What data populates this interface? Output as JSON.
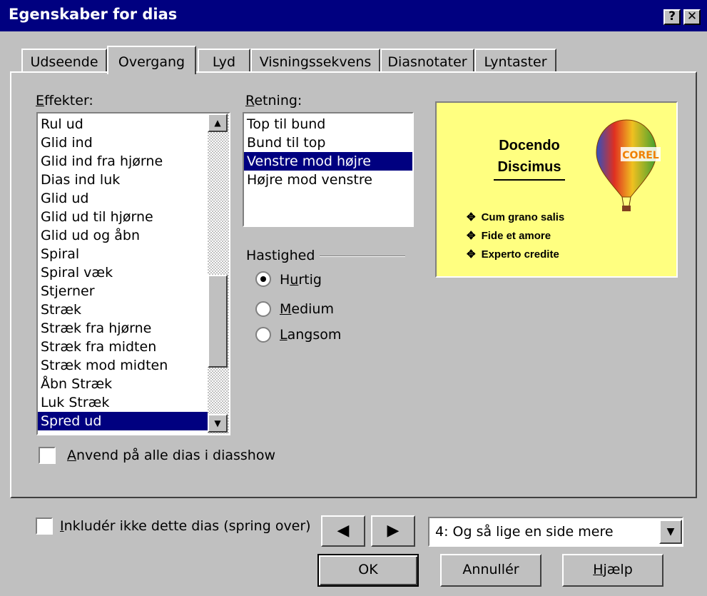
{
  "window": {
    "title": "Egenskaber for dias",
    "help_button": "?",
    "close_button": "✕"
  },
  "tabs": [
    {
      "label": "Udseende"
    },
    {
      "label": "Overgang"
    },
    {
      "label": "Lyd"
    },
    {
      "label": "Visningssekvens"
    },
    {
      "label": "Diasnotater"
    },
    {
      "label": "Lyntaster"
    }
  ],
  "effects": {
    "label": "Effekter:",
    "items": [
      "Rul ud",
      "Glid ind",
      "Glid ind fra hjørne",
      "Dias ind luk",
      "Glid ud",
      "Glid ud til hjørne",
      "Glid ud og åbn",
      "Spiral",
      "Spiral væk",
      "Stjerner",
      "Stræk",
      "Stræk fra hjørne",
      "Stræk fra midten",
      "Stræk mod midten",
      "Åbn Stræk",
      "Luk Stræk",
      "Spred ud"
    ],
    "selected": "Spred ud"
  },
  "direction": {
    "label": "Retning:",
    "items": [
      "Top til bund",
      "Bund til top",
      "Venstre mod højre",
      "Højre mod venstre"
    ],
    "selected": "Venstre mod højre"
  },
  "speed": {
    "label": "Hastighed",
    "options": [
      "Hurtig",
      "Medium",
      "Langsom"
    ],
    "selected": "Hurtig"
  },
  "preview": {
    "title_line1": "Docendo",
    "title_line2": "Discimus",
    "bullets": [
      "Cum grano salis",
      "Fide et amore",
      "Experto credite"
    ],
    "balloon_text": "COREL",
    "bullet_glyph": "✥",
    "background_color": "#ffff80"
  },
  "apply_all": {
    "label": "Anvend på alle dias i diasshow",
    "checked": false
  },
  "skip_slide": {
    "label": "Inkludér ikke dette dias (spring over)",
    "checked": false
  },
  "nav": {
    "prev": "◀",
    "next": "▶"
  },
  "slide_select": {
    "value": "4: Og så lige en side mere",
    "arrow": "▼"
  },
  "buttons": {
    "ok": "OK",
    "cancel": "Annullér",
    "help": "Hjælp"
  },
  "scrollbar": {
    "up": "▲",
    "down": "▼",
    "position": 0.78
  }
}
